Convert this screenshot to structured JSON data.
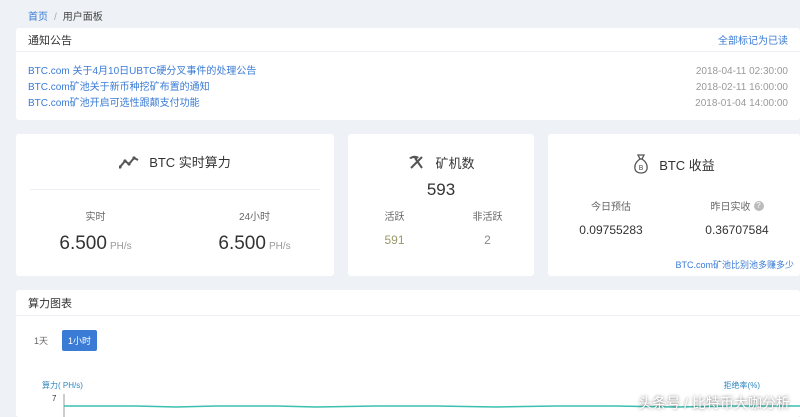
{
  "breadcrumb": {
    "home": "首页",
    "separator": "/",
    "current": "用户面板"
  },
  "notice": {
    "title": "通知公告",
    "mark_all": "全部标记为已读",
    "items": [
      {
        "text": "BTC.com 关于4月10日UBTC硬分叉事件的处理公告",
        "date": "2018-04-11 02:30:00"
      },
      {
        "text": "BTC.com矿池关于新币种挖矿布置的通知",
        "date": "2018-02-11 16:00:00"
      },
      {
        "text": "BTC.com矿池开启可选性跟颠支付功能",
        "date": "2018-01-04 14:00:00"
      }
    ]
  },
  "hashrate": {
    "title": "BTC 实时算力",
    "icon": "trend-line-icon",
    "realtime": {
      "label": "实时",
      "value": "6.500",
      "unit": "PH/s"
    },
    "day": {
      "label": "24小时",
      "value": "6.500",
      "unit": "PH/s"
    }
  },
  "miners": {
    "title": "矿机数",
    "icon": "pickaxe-icon",
    "total": "593",
    "active": {
      "label": "活跃",
      "value": "591"
    },
    "inactive": {
      "label": "非活跃",
      "value": "2"
    }
  },
  "income": {
    "title": "BTC 收益",
    "icon": "money-bag-icon",
    "today": {
      "label": "今日预估",
      "value": "0.09755283"
    },
    "yesterday": {
      "label": "昨日实收",
      "value": "0.36707584"
    },
    "compare_link": "BTC.com矿池比别池多赚多少"
  },
  "chart": {
    "title": "算力图表",
    "ranges": [
      "1天",
      "1小时"
    ],
    "active_range": "1小时",
    "y_left_label": "算力( PH/s)",
    "y_right_label": "拒绝率(%)",
    "y_tick_top": "7"
  },
  "watermark": "头条号 / 比特币大咖分析",
  "colors": {
    "accent": "#3a7bd5",
    "line": "#3bbfb0"
  }
}
